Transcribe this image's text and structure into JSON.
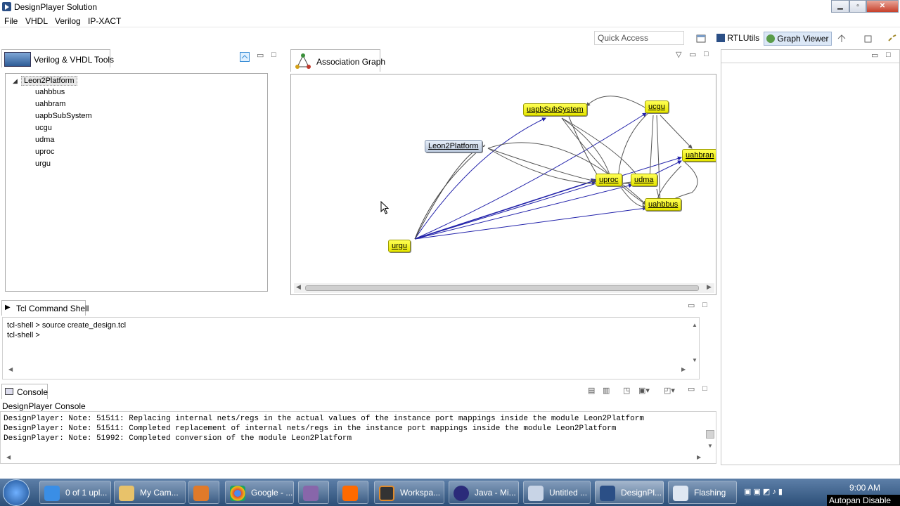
{
  "window": {
    "title": "DesignPlayer Solution"
  },
  "menu": [
    "File",
    "VHDL",
    "Verilog",
    "IP-XACT"
  ],
  "toolbar": {
    "quick_access_placeholder": "Quick Access",
    "rtlutils": "RTLUtils",
    "graph_viewer": "Graph Viewer"
  },
  "left_panel": {
    "tab": "Verilog & VHDL Tools",
    "root": "Leon2Platform",
    "children": [
      "uahbbus",
      "uahbram",
      "uapbSubSystem",
      "ucgu",
      "udma",
      "uproc",
      "urgu"
    ]
  },
  "graph_panel": {
    "tab": "Association Graph",
    "nodes": {
      "root": "Leon2Platform",
      "uapbsub": "uapbSubSystem",
      "ucgu": "ucgu",
      "uahbram": "uahbran",
      "uproc": "uproc",
      "udma": "udma",
      "uahbbus": "uahbbus",
      "urgu": "urgu"
    }
  },
  "tcl_panel": {
    "tab": "Tcl Command Shell",
    "lines": [
      "tcl-shell > source create_design.tcl",
      "tcl-shell >"
    ]
  },
  "console_panel": {
    "tab": "Console",
    "subtitle": "DesignPlayer Console",
    "lines": [
      "DesignPlayer: Note: 51511: Replacing internal nets/regs in the actual values of the instance port mappings inside the module Leon2Platform",
      "DesignPlayer: Note: 51511: Completed replacement of internal nets/regs in the instance port mappings inside the module Leon2Platform",
      "DesignPlayer: Note: 51992: Completed conversion of the module Leon2Platform"
    ]
  },
  "taskbar": {
    "items": [
      "0 of 1 upl...",
      "My Cam...",
      "",
      "Google - ...",
      "",
      "",
      "Workspa...",
      "Java - Mi...",
      "Untitled ...",
      "DesignPl...",
      "Flashing"
    ],
    "clock": "9:00 AM",
    "notice": "Autopan Disable"
  }
}
